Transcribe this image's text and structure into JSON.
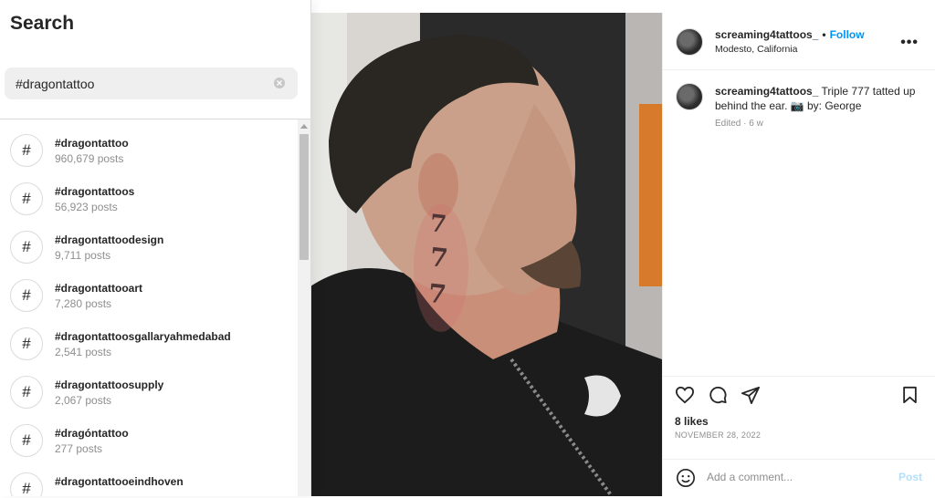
{
  "search": {
    "title": "Search",
    "query": "#dragontattoo",
    "results": [
      {
        "tag": "#dragontattoo",
        "count": "960,679 posts"
      },
      {
        "tag": "#dragontattoos",
        "count": "56,923 posts"
      },
      {
        "tag": "#dragontattoodesign",
        "count": "9,711 posts"
      },
      {
        "tag": "#dragontattooart",
        "count": "7,280 posts"
      },
      {
        "tag": "#dragontattoosgallaryahmedabad",
        "count": "2,541 posts"
      },
      {
        "tag": "#dragontattoosupply",
        "count": "2,067 posts"
      },
      {
        "tag": "#dragóntattoo",
        "count": "277 posts"
      },
      {
        "tag": "#dragontattooeindhoven",
        "count": ""
      }
    ],
    "hash_symbol": "#"
  },
  "post": {
    "username": "screaming4tattoos_",
    "separator": "•",
    "follow_label": "Follow",
    "location": "Modesto, California",
    "more_label": "•••",
    "caption_username": "screaming4tattoos_",
    "caption_text": "Triple 777 tatted up behind the ear. 📷 by: George",
    "caption_meta": "Edited · 6 w",
    "tattoo_text": "777",
    "likes": "8 likes",
    "date": "NOVEMBER 28, 2022",
    "comment_placeholder": "Add a comment...",
    "post_label": "Post"
  },
  "colors": {
    "accent": "#0095f6",
    "post_disabled": "#b2dffc",
    "muted": "#8e8e8e"
  }
}
